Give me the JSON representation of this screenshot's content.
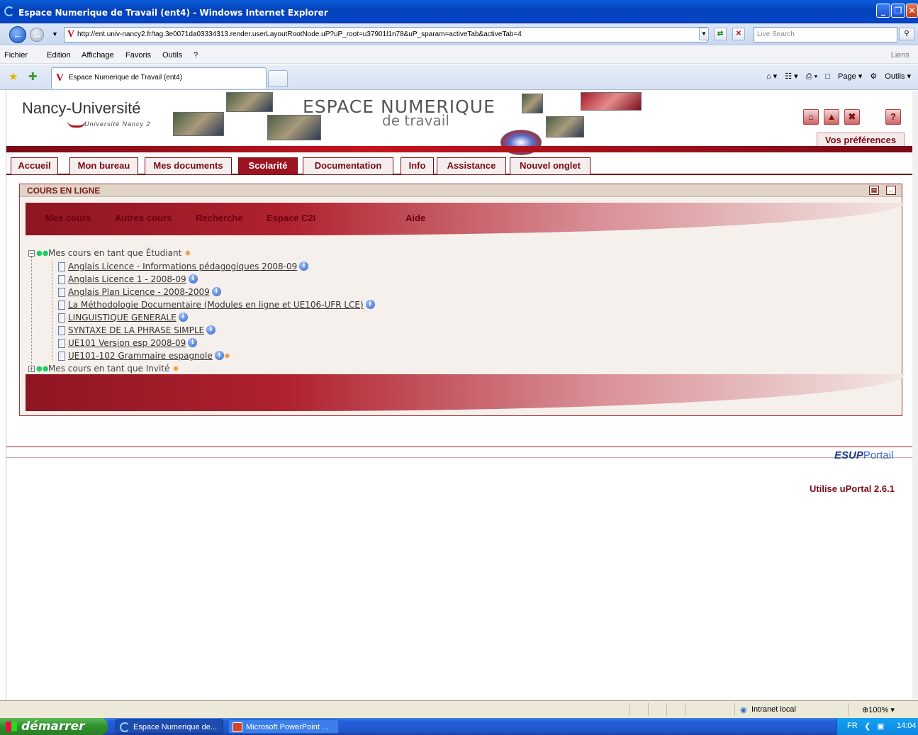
{
  "window": {
    "title": "Espace Numerique de Travail (ent4) - Windows Internet Explorer",
    "buttons": [
      "_",
      "❐",
      "✕"
    ]
  },
  "address_bar": {
    "url": "http://ent.univ-nancy2.fr/tag.3e0071da03334313.render.userLayoutRootNode.uP?uP_root=u37901l1n78&uP_sparam=activeTab&activeTab=4",
    "search_placeholder": "Live Search"
  },
  "menu": {
    "items": [
      "Fichier",
      "Edition",
      "Affichage",
      "Favoris",
      "Outils",
      "?"
    ],
    "links_label": "Liens"
  },
  "browser_tab": {
    "label": "Espace Numerique de Travail (ent4)"
  },
  "command_bar": {
    "page": "Page",
    "tools": "Outils"
  },
  "ent_header": {
    "logo": "Nancy-Université",
    "logo_sub": "Université Nancy 2",
    "title_line1": "ESPACE NUMERIQUE",
    "title_line2": "de travail",
    "preferences": "Vos préférences"
  },
  "ent_tabs": [
    {
      "label": "Accueil",
      "active": false
    },
    {
      "label": "Mon bureau",
      "active": false
    },
    {
      "label": "Mes documents",
      "active": false
    },
    {
      "label": "Scolarité",
      "active": true
    },
    {
      "label": "Documentation",
      "active": false
    },
    {
      "label": "Info",
      "active": false
    },
    {
      "label": "Assistance",
      "active": false
    },
    {
      "label": "Nouvel onglet",
      "active": false
    }
  ],
  "portlet": {
    "title": "COURS EN LIGNE",
    "nav": [
      "Mes cours",
      "Autres cours",
      "Recherche",
      "Espace C2I",
      "Aide"
    ],
    "student_group": "Mes cours en tant que Étudiant",
    "courses": [
      "Anglais Licence - Informations pédagogiques 2008-09",
      "Anglais Licence 1 - 2008-09",
      "Anglais Plan Licence - 2008-2009",
      "La Méthodologie Documentaire (Modules en ligne et UE106-UFR LCE)",
      "LINGUISTIQUE GENERALE",
      "SYNTAXE DE LA PHRASE SIMPLE",
      "UE101 Version esp 2008-09",
      "UE101-102 Grammaire espagnole"
    ],
    "guest_group": "Mes cours en tant que Invité"
  },
  "footer": {
    "esup_brand": "ESUP",
    "esup_portal": "Portail",
    "uportal": "Utilise uPortal 2.6.1"
  },
  "status_bar": {
    "zone": "Intranet local",
    "zoom": "100%"
  },
  "taskbar": {
    "start": "démarrer",
    "items": [
      "Espace Numerique de...",
      "Microsoft PowerPoint ..."
    ],
    "lang": "FR",
    "time": "14:04"
  }
}
